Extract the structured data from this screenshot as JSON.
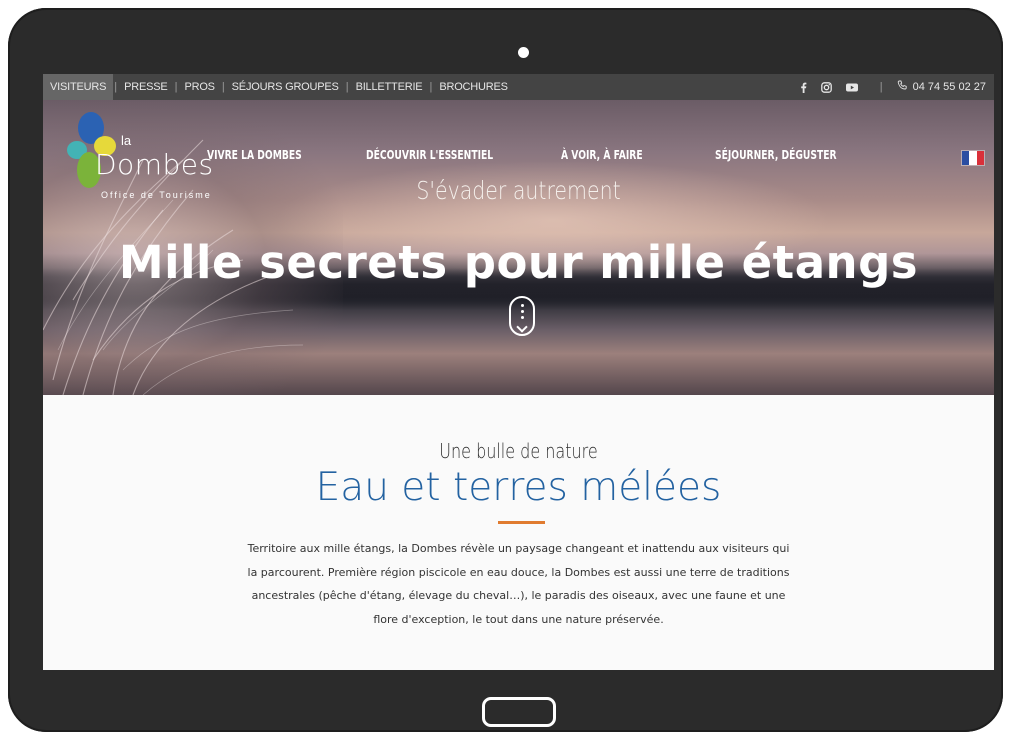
{
  "topbar": {
    "nav": [
      {
        "label": "VISITEURS",
        "active": true
      },
      {
        "label": "PRESSE",
        "active": false
      },
      {
        "label": "PROS",
        "active": false
      },
      {
        "label": "SÉJOURS GROUPES",
        "active": false
      },
      {
        "label": "BILLETTERIE",
        "active": false
      },
      {
        "label": "BROCHURES",
        "active": false
      }
    ],
    "social": [
      "facebook-icon",
      "instagram-icon",
      "youtube-icon"
    ],
    "phone": "04 74 55 02 27"
  },
  "header": {
    "logo": {
      "la": "la",
      "name": "Dombes",
      "subtitle": "Office de Tourisme"
    },
    "menu": [
      "VIVRE LA DOMBES",
      "DÉCOUVRIR L'ESSENTIEL",
      "À VOIR, À FAIRE",
      "SÉJOURNER, DÉGUSTER"
    ],
    "language_flag": "fr-flag-icon"
  },
  "hero": {
    "tagline": "S'évader autrement",
    "title": "Mille secrets pour mille étangs"
  },
  "content": {
    "kicker": "Une bulle de nature",
    "title": "Eau et terres mélées",
    "description": "Territoire aux mille étangs, la Dombes révèle un paysage changeant et inattendu aux visiteurs qui la parcourent. Première région piscicole en eau douce, la Dombes est aussi une terre de traditions ancestrales (pêche d'étang, élevage du cheval…), le paradis des oiseaux, avec une faune et une flore d'exception, le tout dans une nature préservée."
  },
  "colors": {
    "accent_blue": "#2362a1",
    "accent_orange": "#e07b30",
    "topbar": "#444444"
  }
}
